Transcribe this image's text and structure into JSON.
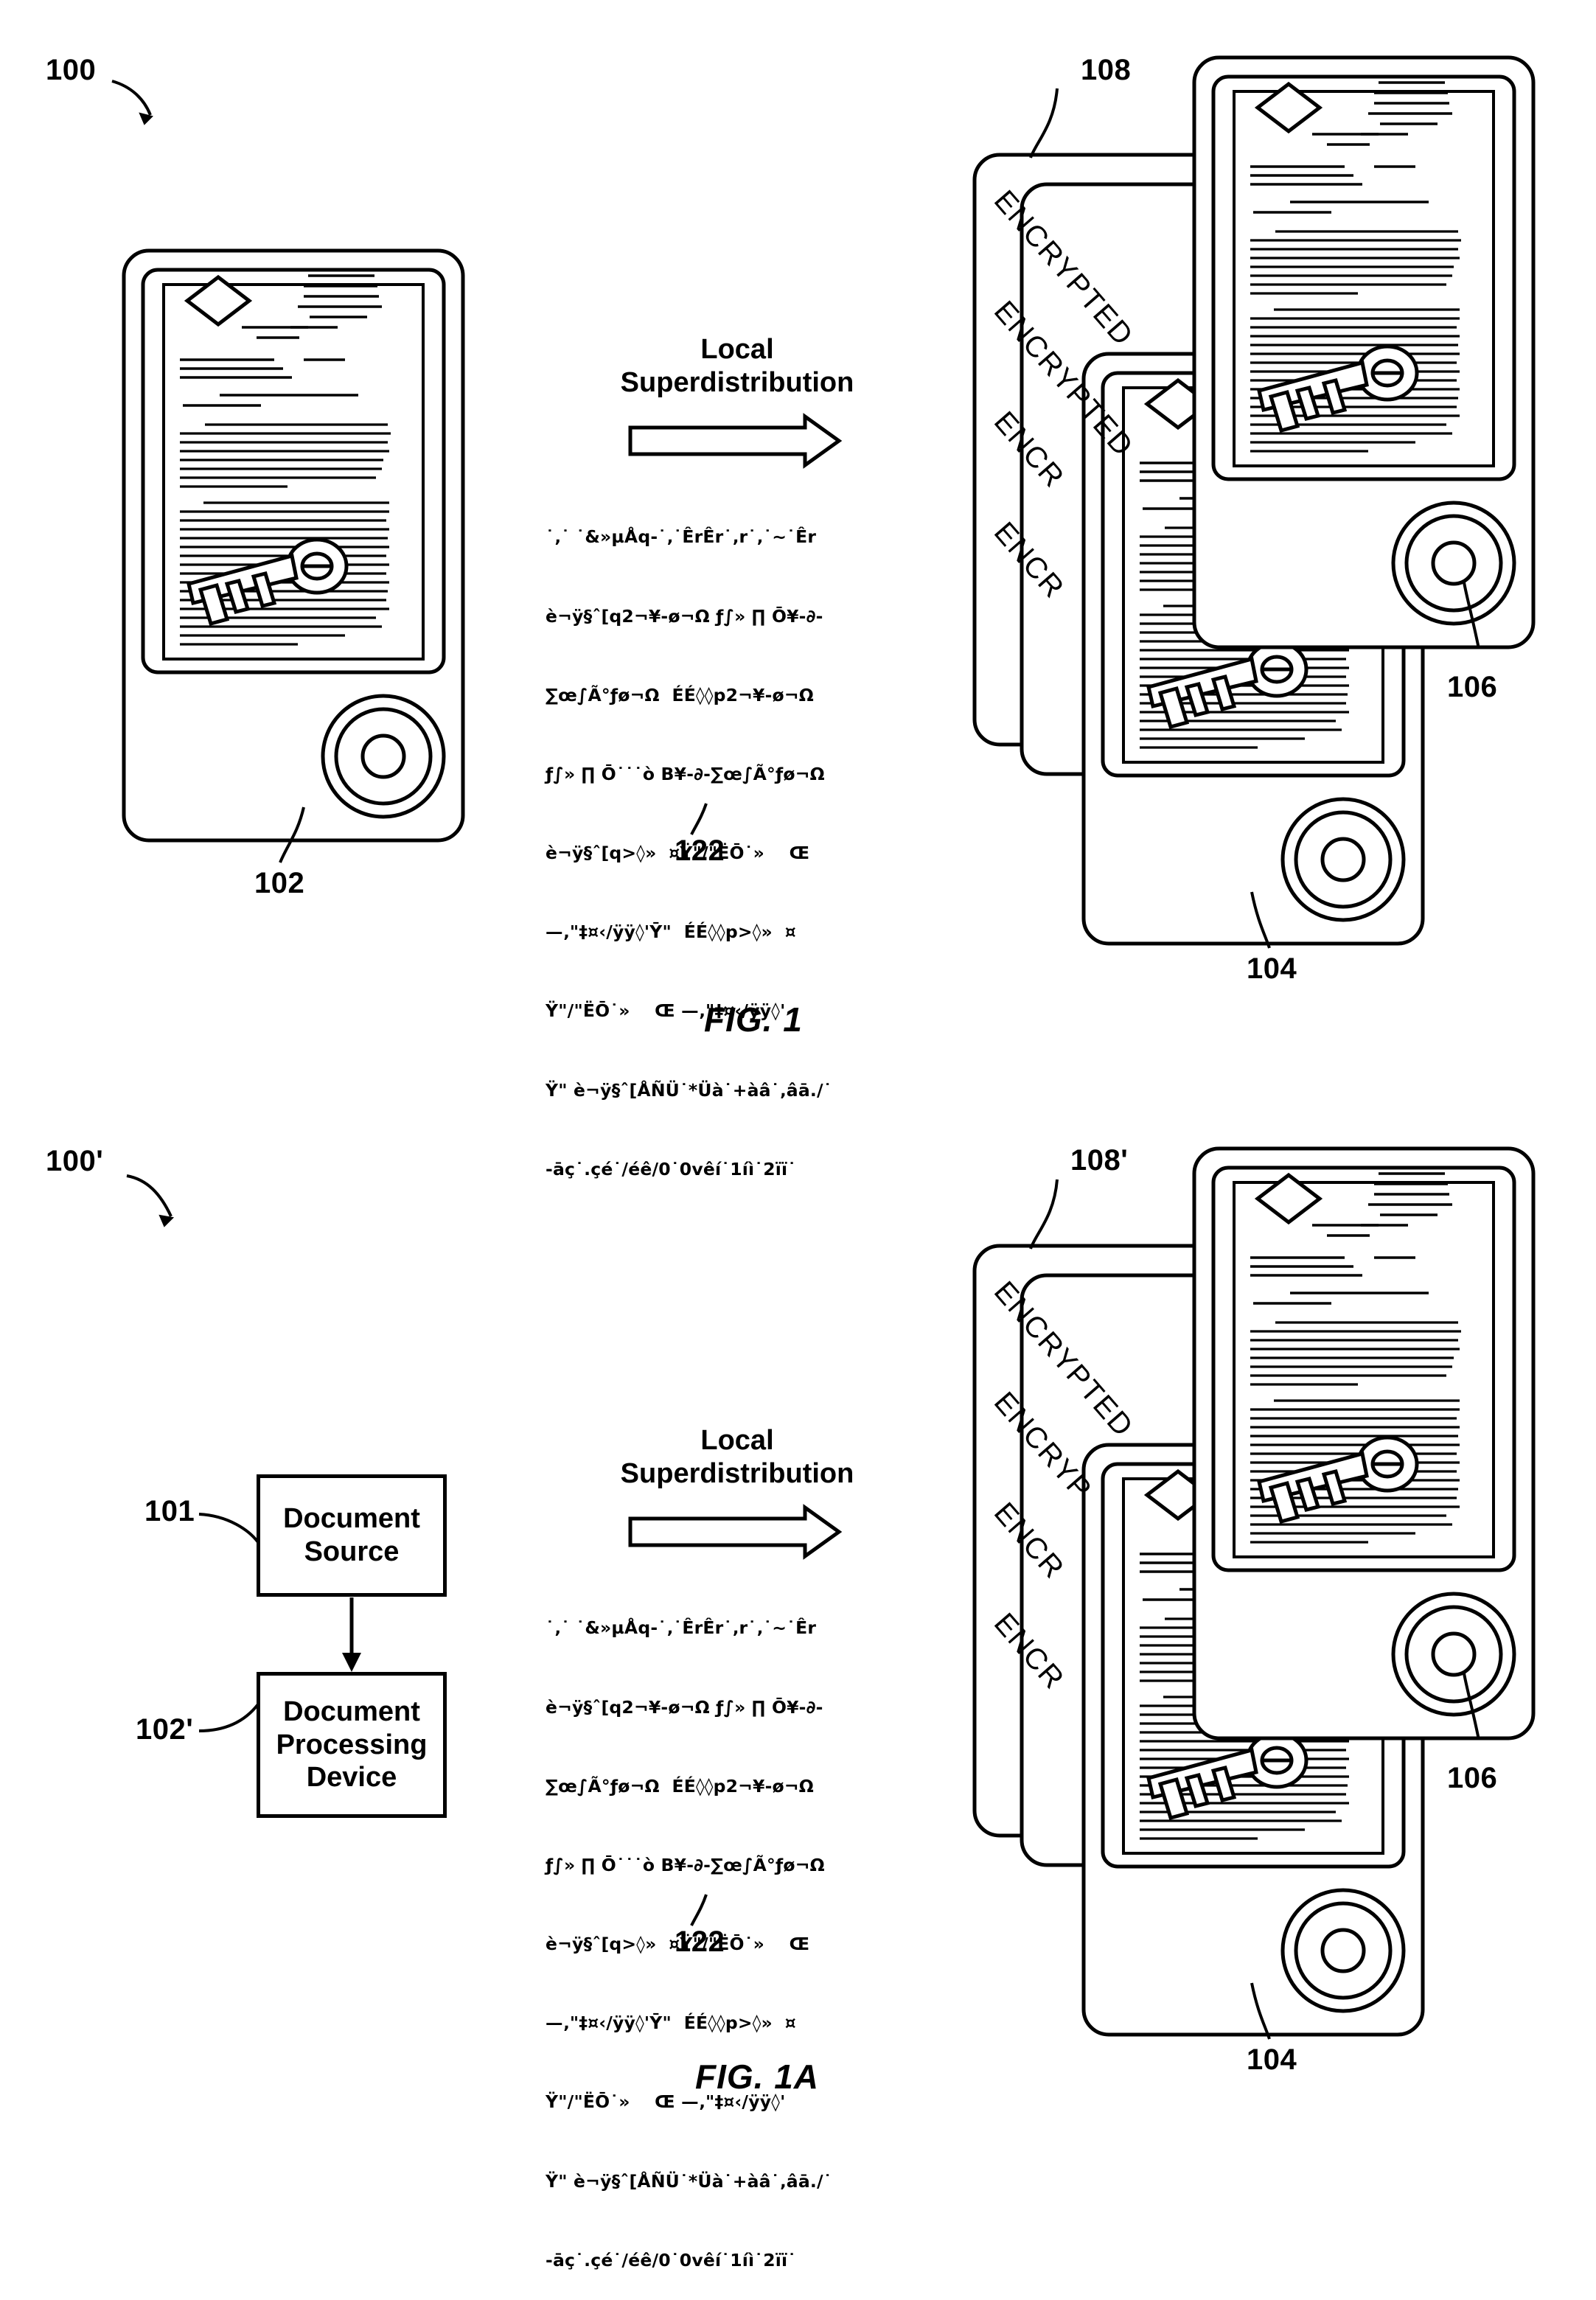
{
  "figures": [
    {
      "id": "fig1",
      "caption": "FIG. 1",
      "system_ref": "100",
      "labels": {
        "source_device": "102",
        "encrypted_stack": "108",
        "receiving_device_back": "106",
        "receiving_device_front": "104",
        "cipher_block": "122"
      },
      "arrow_title_line1": "Local",
      "arrow_title_line2": "Superdistribution",
      "encrypted_watermarks": [
        "ENCRYPTED",
        "ENCRYPTED",
        "ENCR",
        "ENCR"
      ],
      "cipher_lines": [
        "˙‚˙ ˙&»µÅq-˙‚˙ÊrÊr˙‚r˙‚˙~˙Êr",
        "è¬ÿ§ˆ[q2¬¥-ø¬Ω ƒ∫» ∏ Ō¥-∂-",
        "∑œ∫Ã°ƒø¬Ω  ÉÉ◊◊p2¬¥-ø¬Ω",
        "ƒ∫» ∏ Ō˙˙˙ò B¥-∂-∑œ∫Ã°ƒø¬Ω",
        "è¬ÿ§ˆ[q>◊»  ¤Ÿ\"/\"ËŌ˙»    Œ",
        "—‚\"‡¤‹/ÿÿ◊'Ȳ\"  ÉÉ◊◊p>◊»  ¤",
        "Ÿ\"/\"ËŌ˙»    Œ —‚\"‡¤‹/ÿÿ◊'",
        "Ÿ\" è¬ÿ§ˆ[ÅÑÜ˙*Üà˙+àâ˙‚âā./˙",
        "-āç˙.çé˙/éê/0˙0vêí˙1íì˙2ïï˙"
      ]
    },
    {
      "id": "fig1a",
      "caption": "FIG. 1A",
      "system_ref": "100'",
      "labels": {
        "document_source": "101",
        "document_processing_device": "102'",
        "encrypted_stack": "108'",
        "receiving_device_back": "106",
        "receiving_device_front": "104",
        "cipher_block": "122"
      },
      "arrow_title_line1": "Local",
      "arrow_title_line2": "Superdistribution",
      "boxes": [
        {
          "name": "document-source-box",
          "text": "Document\nSource"
        },
        {
          "name": "document-processing-device-box",
          "text": "Document\nProcessing\nDevice"
        }
      ],
      "encrypted_watermarks": [
        "ENCRYPTED",
        "ENCRYP",
        "ENCR",
        "ENCR"
      ],
      "cipher_lines": [
        "˙‚˙ ˙&»µÅq-˙‚˙ÊrÊr˙‚r˙‚˙~˙Êr",
        "è¬ÿ§ˆ[q2¬¥-ø¬Ω ƒ∫» ∏ Ō¥-∂-",
        "∑œ∫Ã°ƒø¬Ω  ÉÉ◊◊p2¬¥-ø¬Ω",
        "ƒ∫» ∏ Ō˙˙˙ò B¥-∂-∑œ∫Ã°ƒø¬Ω",
        "è¬ÿ§ˆ[q>◊»  ¤Ÿ\"/\"ËŌ˙»    Œ",
        "—‚\"‡¤‹/ÿÿ◊'Ȳ\"  ÉÉ◊◊p>◊»  ¤",
        "Ÿ\"/\"ËŌ˙»    Œ —‚\"‡¤‹/ÿÿ◊'",
        "Ÿ\" è¬ÿ§ˆ[ÅÑÜ˙*Üà˙+àâ˙‚âā./˙",
        "-āç˙.çé˙/éê/0˙0vêí˙1íì˙2ïï˙"
      ]
    }
  ],
  "colors": {
    "ink": "#000000",
    "paper": "#ffffff"
  }
}
